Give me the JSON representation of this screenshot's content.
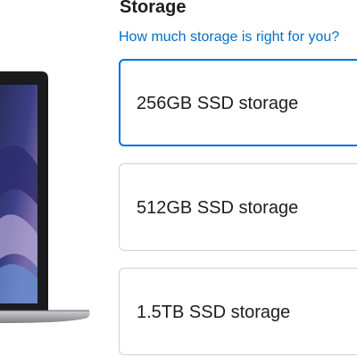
{
  "storage": {
    "heading": "Storage",
    "help_link": "How much storage is right for you?",
    "options": [
      {
        "label": "256GB SSD storage",
        "selected": true
      },
      {
        "label": "512GB SSD storage",
        "selected": false
      },
      {
        "label": "1.5TB SSD storage",
        "selected": false
      }
    ]
  },
  "colors": {
    "accent": "#0071e3",
    "link": "#0070c9",
    "text": "#1d1d1f",
    "border": "#d2d2d7"
  }
}
